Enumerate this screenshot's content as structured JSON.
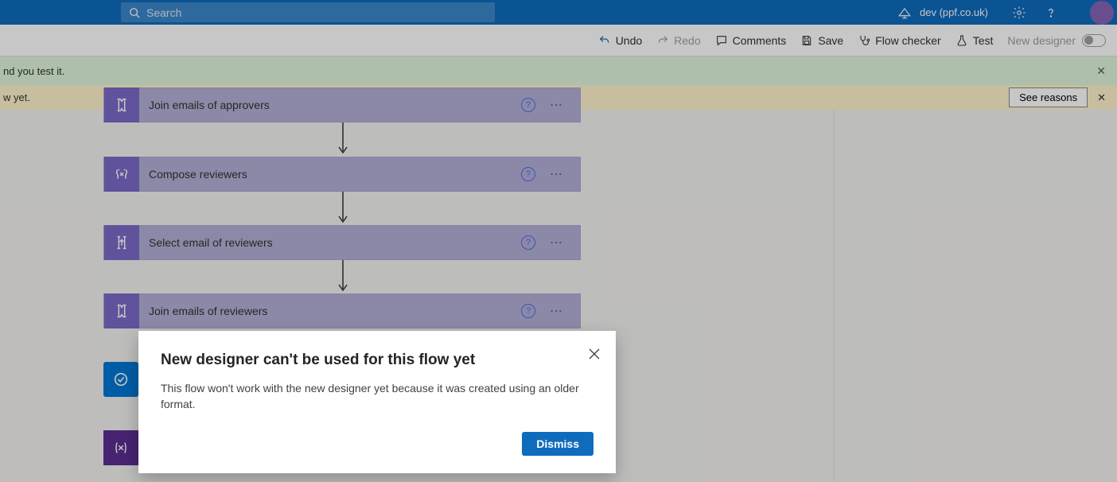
{
  "header": {
    "search_placeholder": "Search",
    "environment": "dev (ppf.co.uk)"
  },
  "toolbar": {
    "undo": "Undo",
    "redo": "Redo",
    "comments": "Comments",
    "save": "Save",
    "flowchecker": "Flow checker",
    "test": "Test",
    "newdesigner": "New designer"
  },
  "banners": {
    "green_text": "nd you test it.",
    "yellow_text": "w yet.",
    "see_reasons": "See reasons"
  },
  "steps": {
    "s0": "Join emails of approvers",
    "s1": "Compose reviewers",
    "s2": "Select email of reviewers",
    "s3": "Join emails of reviewers"
  },
  "dialog": {
    "title": "New designer can't be used for this flow yet",
    "body": "This flow won't work with the new designer yet because it was created using an older format.",
    "dismiss": "Dismiss"
  }
}
